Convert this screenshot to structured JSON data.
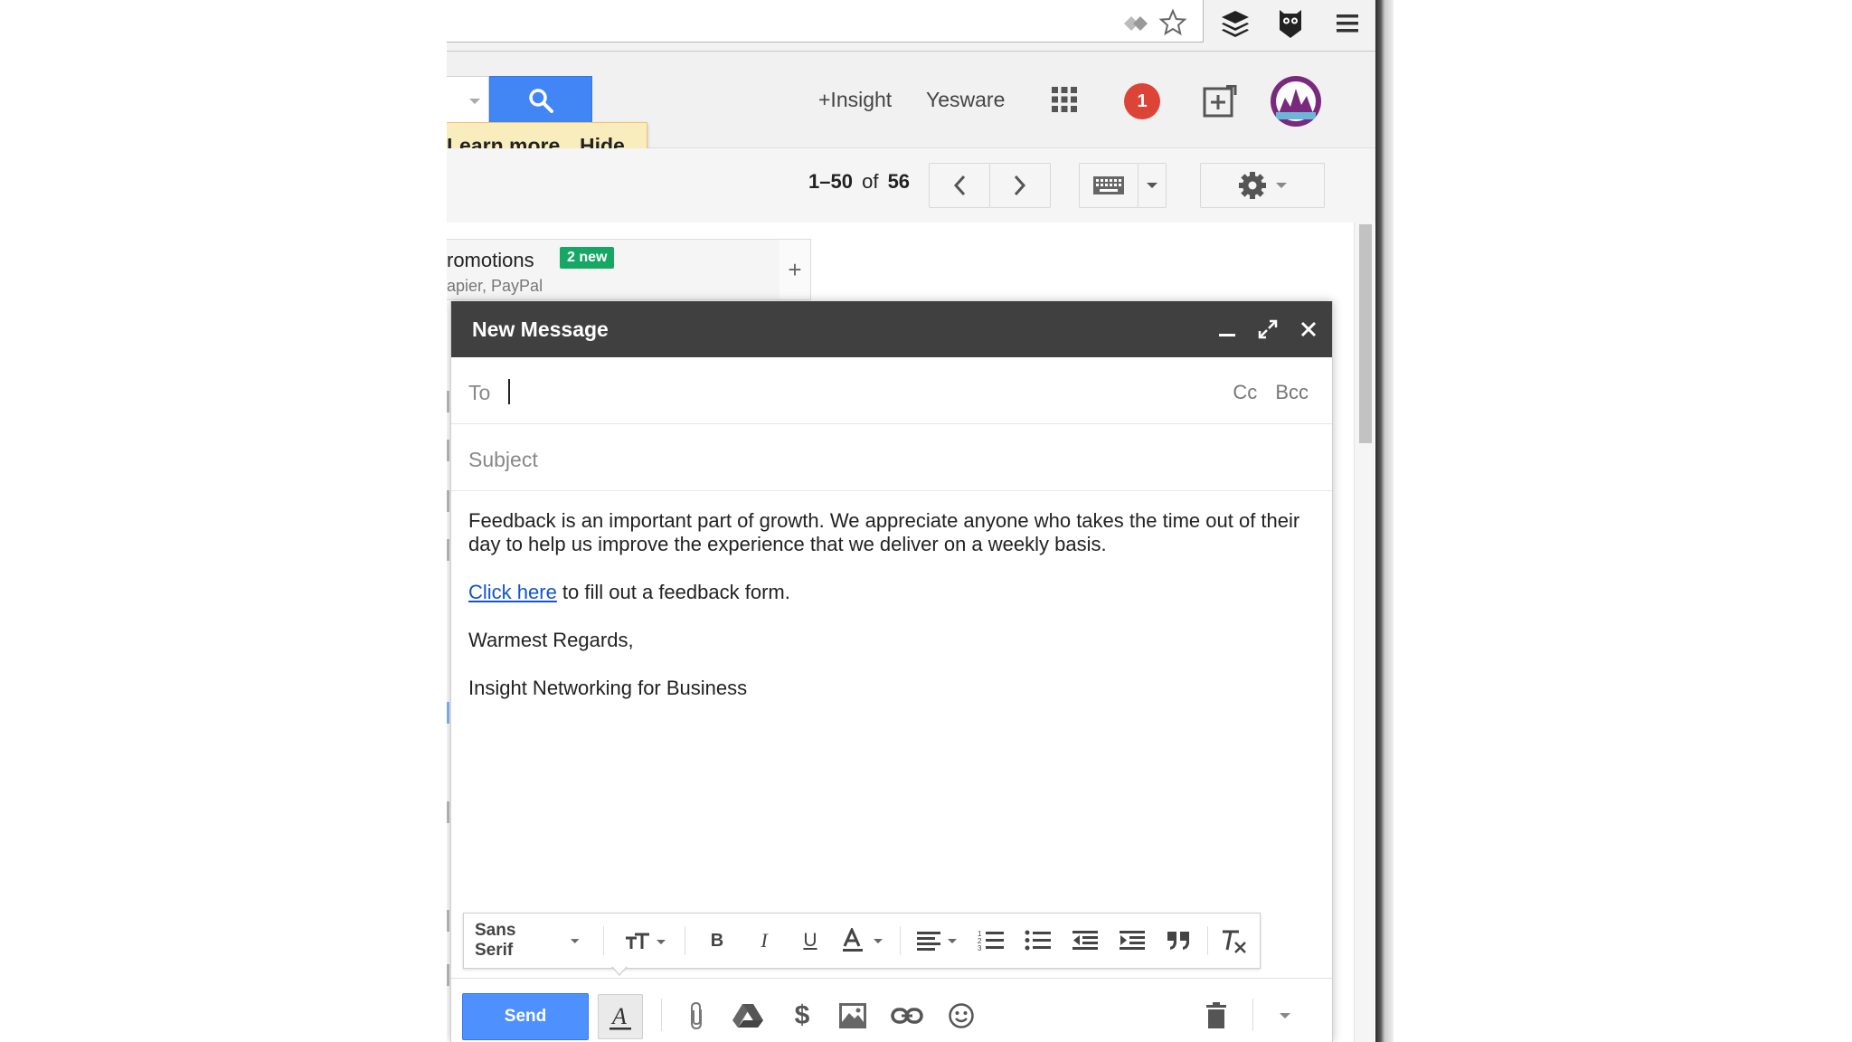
{
  "header": {
    "insight_link": "+Insight",
    "yesware_link": "Yesware",
    "notification_count": "1"
  },
  "notice": {
    "learn_more": "Learn more",
    "hide": "Hide"
  },
  "pagination": {
    "range": "1–50",
    "of_label": "of",
    "total": "56"
  },
  "tabs": {
    "promotions_label": "romotions",
    "promotions_badge": "2 new",
    "promotions_senders": "apier, PayPal",
    "add_tab_symbol": "+"
  },
  "compose": {
    "title": "New Message",
    "to_label": "To",
    "cc_bcc": "Cc Bcc",
    "subject_placeholder": "Subject",
    "body": {
      "paragraph1": "Feedback is an important part of growth.  We appreciate anyone who takes the time out of their day to help us improve the experience that we deliver on a weekly basis.",
      "link_text": "Click here",
      "link_rest": " to fill out a feedback form.",
      "closing": "Warmest Regards,",
      "signature": "Insight Networking for Business"
    },
    "format_bar": {
      "font_name": "Sans Serif"
    },
    "send_label": "Send"
  },
  "colors": {
    "send_blue": "#4d90fe",
    "search_blue": "#4285f4",
    "compose_header": "#404040",
    "badge_green": "#16a765",
    "notification_red": "#db4437",
    "link_blue": "#1155cc"
  }
}
